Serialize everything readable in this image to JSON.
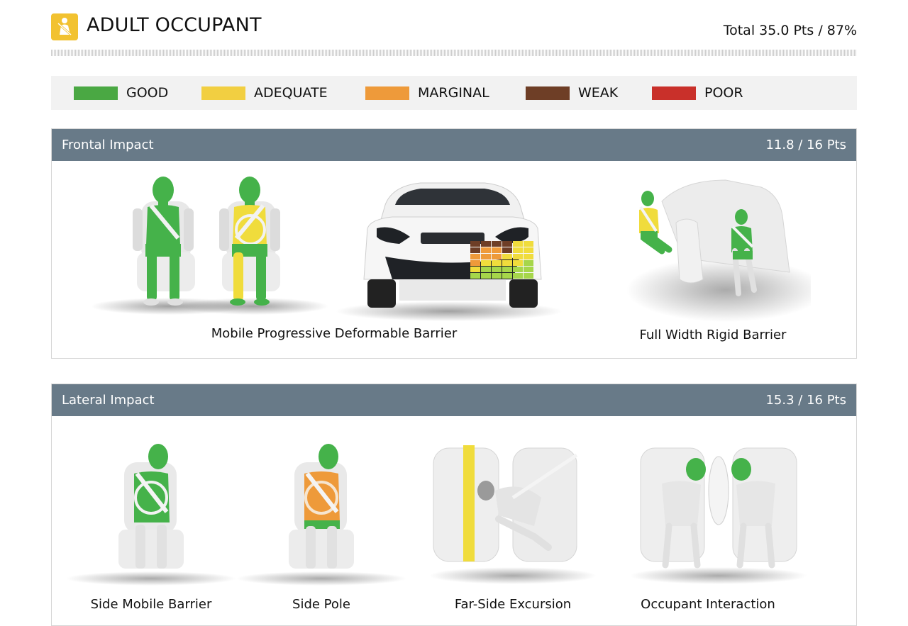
{
  "header": {
    "icon": "seatbelt-occupant-icon",
    "title": "ADULT OCCUPANT",
    "total": "Total 35.0 Pts / 87%"
  },
  "legend": [
    {
      "label": "GOOD",
      "color": "#4aa843"
    },
    {
      "label": "ADEQUATE",
      "color": "#f2cf41"
    },
    {
      "label": "MARGINAL",
      "color": "#ee9a3a"
    },
    {
      "label": "WEAK",
      "color": "#6e3e26"
    },
    {
      "label": "POOR",
      "color": "#c9302a"
    }
  ],
  "frontal": {
    "title": "Frontal Impact",
    "score": "11.8 / 16 Pts",
    "tests": [
      {
        "label": "Mobile Progressive Deformable Barrier"
      },
      {
        "label": "Full Width Rigid Barrier"
      }
    ]
  },
  "lateral": {
    "title": "Lateral Impact",
    "score": "15.3 / 16 Pts",
    "tests": [
      {
        "label": "Side Mobile Barrier"
      },
      {
        "label": "Side Pole"
      },
      {
        "label": "Far-Side Excursion"
      },
      {
        "label": "Occupant Interaction"
      }
    ]
  },
  "colors": {
    "good": "#4aa843",
    "adequate": "#f2cf41",
    "marginal": "#ee9a3a",
    "weak": "#6e3e26",
    "poor": "#c9302a",
    "panel_bar": "#687a88"
  }
}
